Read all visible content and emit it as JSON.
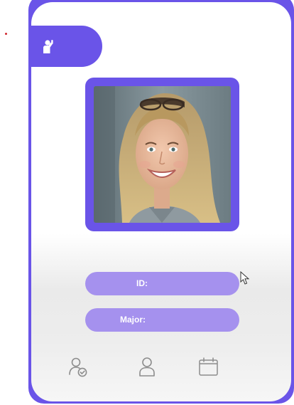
{
  "header": {
    "icon": "hand-raise-person-icon"
  },
  "profile": {
    "photo": "profile-photo"
  },
  "fields": {
    "id_label": "ID:",
    "major_label": "Major:"
  },
  "nav": {
    "items": [
      {
        "icon": "user-check-icon"
      },
      {
        "icon": "user-icon"
      },
      {
        "icon": "calendar-icon"
      }
    ]
  },
  "colors": {
    "accent": "#6a54e8",
    "field_fill": "#a591ee",
    "field_text": "#ffffff",
    "nav_icon": "#8c8c8c"
  }
}
